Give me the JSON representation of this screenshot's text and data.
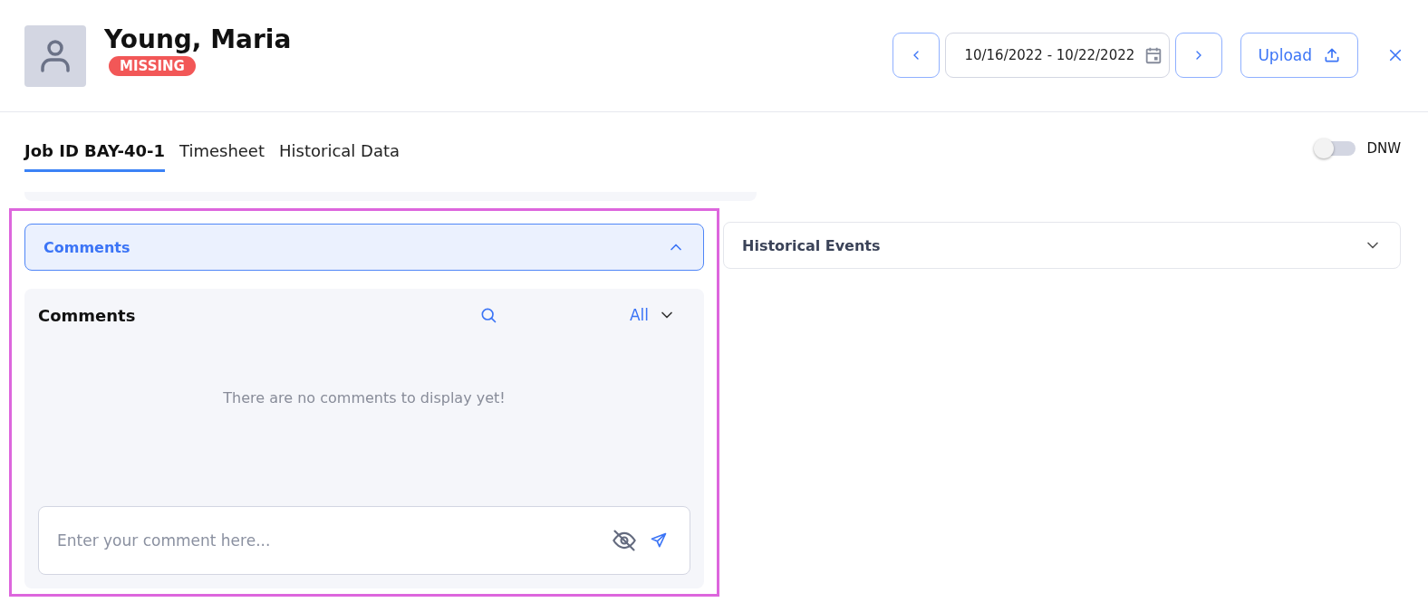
{
  "header": {
    "name": "Young, Maria",
    "status": "MISSING",
    "date_range": "10/16/2022 - 10/22/2022",
    "upload_label": "Upload"
  },
  "tabs": [
    {
      "label": "Job ID BAY-40-1",
      "selected": true
    },
    {
      "label": "Timesheet",
      "selected": false
    },
    {
      "label": "Historical Data",
      "selected": false
    }
  ],
  "dnw_toggle": {
    "label": "DNW",
    "on": false
  },
  "accordions": [
    {
      "title": "Comments",
      "expanded": true
    },
    {
      "title": "Historical Events",
      "expanded": false
    }
  ],
  "comments": {
    "title": "Comments",
    "filter": "All",
    "empty_message": "There are no comments to display yet!",
    "input_placeholder": "Enter your comment here..."
  }
}
